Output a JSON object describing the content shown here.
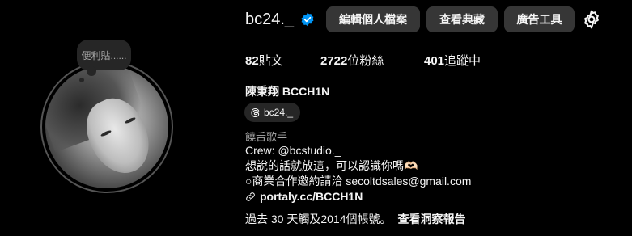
{
  "profile": {
    "note": "便利貼......",
    "username": "bc24._",
    "buttons": {
      "edit_profile": "編輯個人檔案",
      "view_archive": "查看典藏",
      "ad_tools": "廣告工具"
    },
    "stats": {
      "posts_count": "82",
      "posts_label": "貼文",
      "followers_count": "2722",
      "followers_label": "位粉絲",
      "following_count": "401",
      "following_label": "追蹤中"
    },
    "full_name": "陳秉翔 BCCH1N",
    "threads_handle": "bc24._",
    "category": "饒舌歌手",
    "bio_lines": [
      "Crew: @bcstudio._",
      "想說的話就放這，可以認識你嗎🫶🏻",
      "○商業合作邀約請洽 secoltdsales@gmail.com"
    ],
    "link": "portaly.cc/BCCH1N",
    "insights_text": "過去 30 天觸及2014個帳號。",
    "insights_link": "查看洞察報告"
  },
  "colors": {
    "background": "#000000",
    "button_bg": "#363636",
    "verified_blue": "#0095f6",
    "secondary_text": "#a8a8a8"
  },
  "icons": [
    "verified-badge-icon",
    "settings-gear-icon",
    "threads-icon",
    "link-icon"
  ]
}
